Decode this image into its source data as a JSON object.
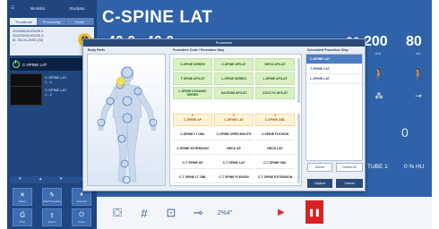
{
  "left_panel": {
    "menu_label": "Worklist",
    "panel_label": "StudyNo",
    "tabs": [
      "Thumbnail",
      "Processing",
      "Guide"
    ],
    "patient_info": [
      "20220902143225 2",
      "20220902143225 2",
      "M, 05-04-2000 (22)",
      "--"
    ],
    "current_series": "C-SPINE LAT",
    "series": [
      {
        "title": "C-SPINE LAT",
        "sub": "1 - 1"
      },
      {
        "title": "C-SPINE LAT",
        "sub": "1 - 2"
      }
    ],
    "buttons": [
      {
        "label": "Reject"
      },
      {
        "label": "Edit Procedure"
      },
      {
        "label": "Suspend"
      },
      {
        "label": "Print"
      },
      {
        "label": "Export"
      },
      {
        "label": "Close"
      }
    ]
  },
  "main": {
    "title": "C-SPINE LAT",
    "kv_value": "40.0",
    "kv2_value": "40.0",
    "sid_value": "80",
    "ma_value": "200",
    "ms_value": "80",
    "ma_unit": "mA",
    "ms_unit": "ms",
    "angle_value": "0",
    "tube_label": "TUBE 1",
    "hu_label": "0 % HU",
    "angle_chip": "2%4°",
    "ready_text": "Lorem Imkrsin"
  },
  "dialog": {
    "title": "Procedure",
    "col_body": "Body Parts",
    "col_proc": "Procedure Code / Procedure Step",
    "col_sched": "Scheduled Procedure Step",
    "green_procs": [
      "C-SPINE SERIES",
      "C-SPINE AP/LAT",
      "NECK AP/LAT",
      "T-SPINE AP/LAT",
      "L-SPINE SERIES",
      "L-SPINE AP/LAT",
      "L-SPINE DYNAMIC SERIES",
      "SACRUM AP/LAT",
      "COCCYX AP/LAT"
    ],
    "orange_procs": [
      "C-SPINE AP",
      "C-SPINE LAT",
      "C-SPINE OBL"
    ],
    "white_procs": [
      "C-SPINE LT OBL",
      "C-SPINE OPEN MOUTH",
      "C-SPINE FLEXION",
      "C-SPINE EXTENSION",
      "NECK AP",
      "NECK LAT",
      "C-T SPINE AP",
      "C-T SPINE LAT",
      "C-T SPINE OBL",
      "C-T SPINE LT OBL",
      "C-T SPINE FLEXION",
      "C-T SPINE EXTENSION"
    ],
    "scheduled": [
      "C-SPINE LAT",
      "T-SPINE LAT",
      "L-SPINE LAT"
    ],
    "btn_delete": "Delete",
    "btn_delete_all": "Delete All",
    "btn_capture": "Capture",
    "btn_cancel": "Cancel"
  },
  "colors": {
    "app_bg": "#2f62a8",
    "accent_green": "#d8f0c4",
    "accent_orange": "#fff3d6",
    "stop_red": "#d62222"
  }
}
